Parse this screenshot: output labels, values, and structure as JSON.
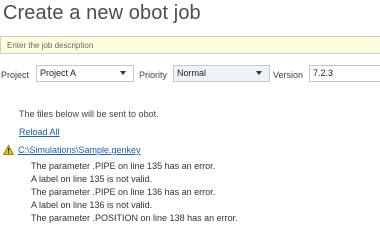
{
  "page": {
    "title": "Create a new obot job"
  },
  "description": {
    "placeholder": "Enter the job description",
    "value": ""
  },
  "form": {
    "project_label": "Project",
    "project_value": "Project A",
    "priority_label": "Priority",
    "priority_value": "Normal",
    "version_label": "Version",
    "version_value": "7.2.3"
  },
  "files": {
    "info_text": "The files below will be sent to obot.",
    "reload_label": "Reload All",
    "file_path": "C:\\Simulations\\Sample.genkey",
    "warning_icon": "warning-icon",
    "errors": [
      "The parameter .PIPE on line 135 has an error.",
      "A label on line 135 is not valid.",
      "The parameter .PIPE on line 136 has an error.",
      "A label on line 136 is not valid.",
      "The parameter .POSITION on line 138 has an error."
    ]
  },
  "colors": {
    "link": "#1a5fb4",
    "description_background": "#fdfde0",
    "warning": "#f2c200"
  }
}
